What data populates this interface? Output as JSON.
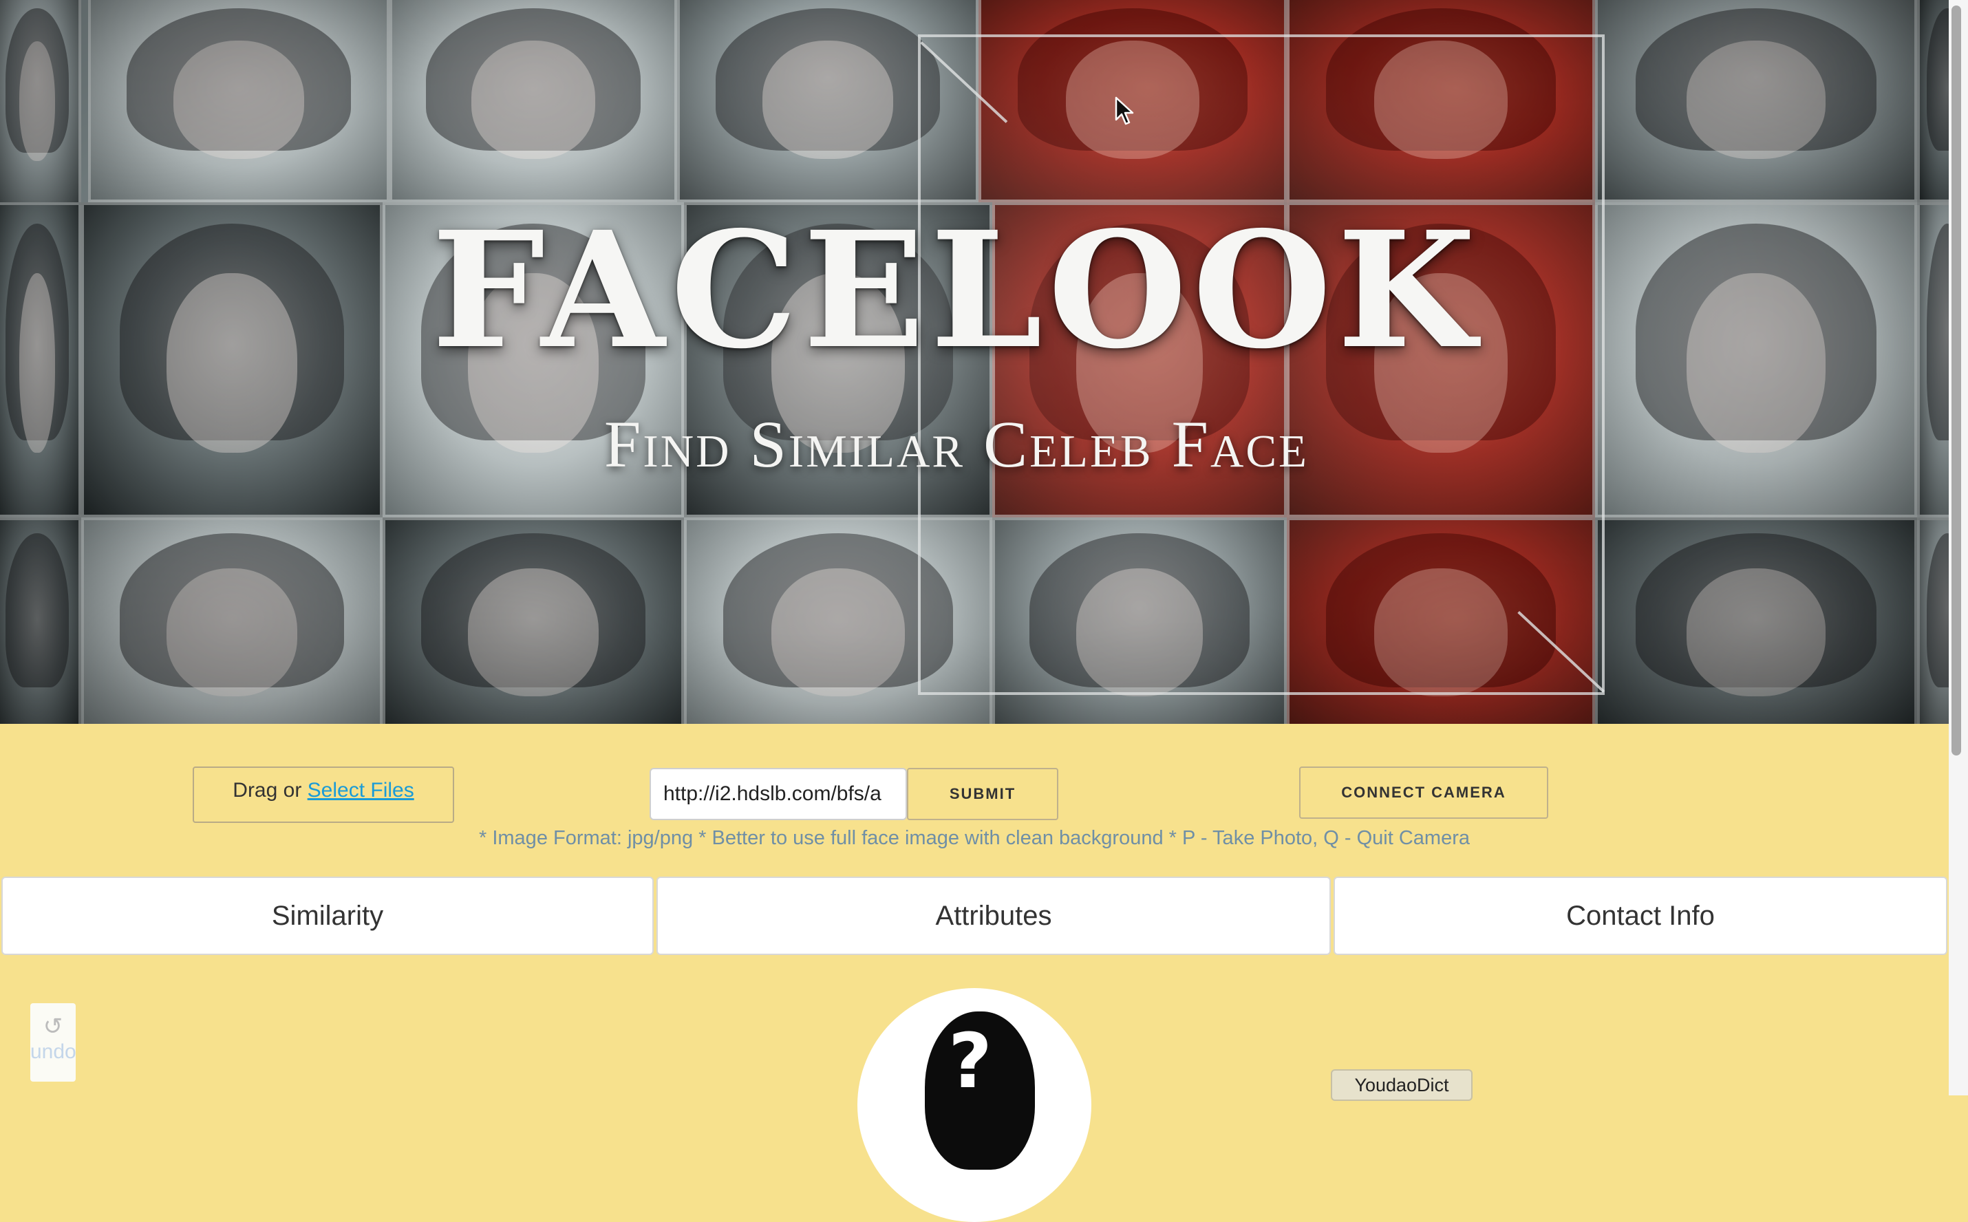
{
  "hero": {
    "title": "FACELOOK",
    "subtitle": "Find Similar Celeb Face"
  },
  "upload": {
    "prefix": "Drag or ",
    "link_label": "Select Files"
  },
  "url_input": {
    "value": "http://i2.hdslb.com/bfs/a"
  },
  "buttons": {
    "submit_label": "SUBMIT",
    "camera_label": "CONNECT CAMERA"
  },
  "hint": "* Image Format: jpg/png * Better to use full face image with clean background * P - Take Photo, Q - Quit Camera",
  "tabs": [
    {
      "label": "Similarity"
    },
    {
      "label": "Attributes"
    },
    {
      "label": "Contact Info"
    }
  ],
  "undo": {
    "icon": "undo-arrow-icon",
    "label": "undo"
  },
  "avatar": {
    "icon": "unknown-person-icon",
    "glyph": "?"
  },
  "popup": {
    "label": "YoudaoDict"
  },
  "colors": {
    "background": "#f7e18d",
    "link": "#1a9bd7",
    "hint_text": "#6f8fa6"
  }
}
